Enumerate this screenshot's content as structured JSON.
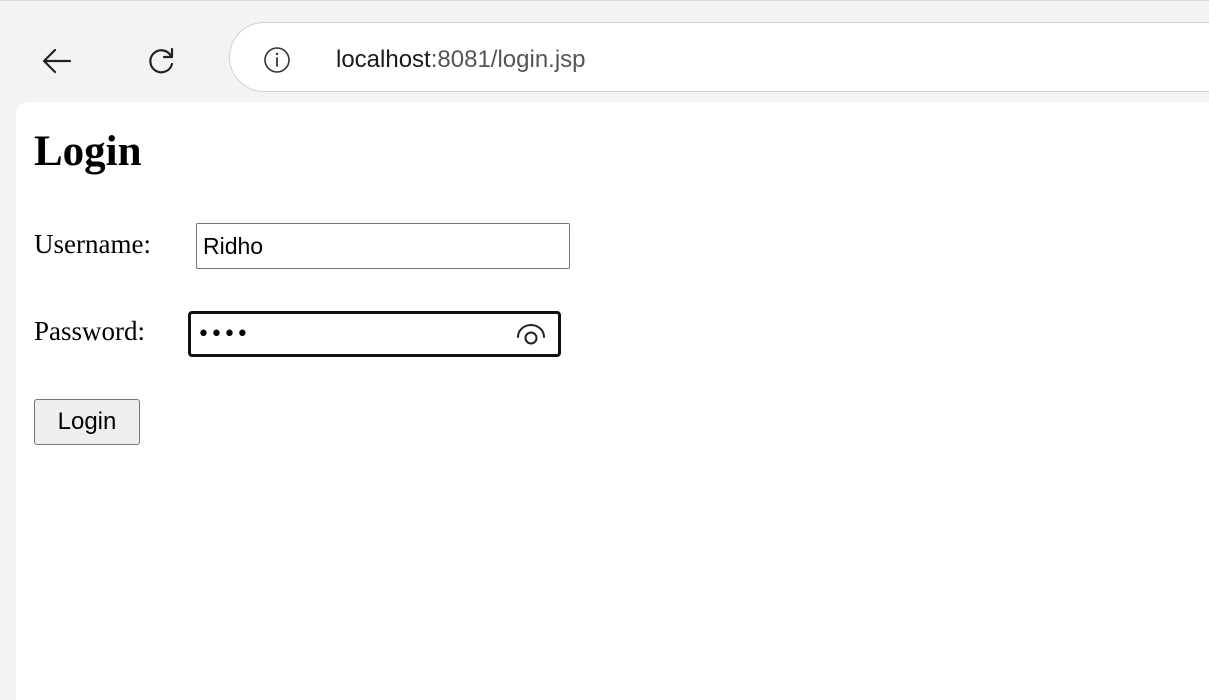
{
  "browser": {
    "url_host": "localhost",
    "url_path": ":8081/login.jsp",
    "icons": {
      "back": "back-arrow-icon",
      "reload": "reload-icon",
      "site_info": "info-icon"
    }
  },
  "page": {
    "title": "Login",
    "username_label": "Username:",
    "username_value": "Ridho",
    "password_label": "Password:",
    "password_value": "••••",
    "password_reveal_icon": "eye-icon",
    "submit_label": "Login"
  }
}
